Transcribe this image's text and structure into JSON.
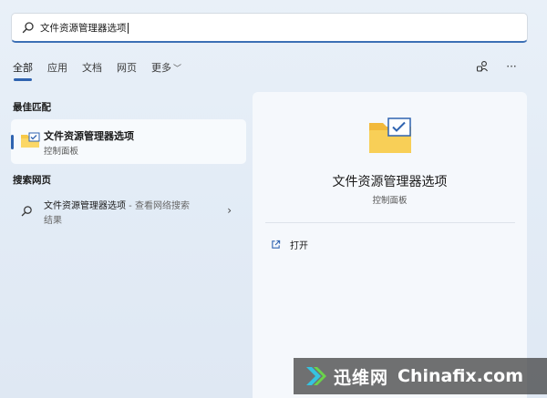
{
  "search": {
    "query": "文件资源管理器选项"
  },
  "tabs": [
    {
      "label": "全部"
    },
    {
      "label": "应用"
    },
    {
      "label": "文档"
    },
    {
      "label": "网页"
    },
    {
      "label": "更多"
    }
  ],
  "sections": {
    "best_match": "最佳匹配",
    "web_search": "搜索网页"
  },
  "best_match": {
    "title": "文件资源管理器选项",
    "subtitle": "控制面板"
  },
  "web_result": {
    "title": "文件资源管理器选项",
    "suffix": " - 查看网络搜索",
    "line2": "结果"
  },
  "detail": {
    "title": "文件资源管理器选项",
    "subtitle": "控制面板",
    "action_open": "打开"
  },
  "watermark": {
    "cn": "迅维网",
    "en": "Chinafix.com"
  },
  "colors": {
    "accent": "#2f63b0",
    "folder": "#f7c948",
    "check": "#2f63b0"
  }
}
